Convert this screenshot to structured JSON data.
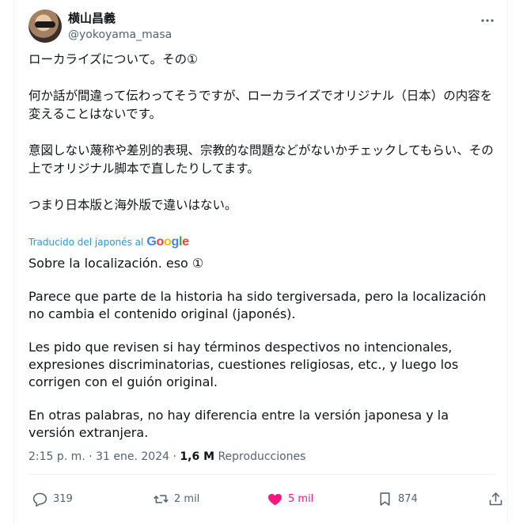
{
  "user": {
    "display_name": "横山昌義",
    "handle": "@yokoyama_masa"
  },
  "tweet": {
    "jp_paragraphs": [
      "ローカライズについて。その①",
      "何か話が間違って伝わってそうですが、ローカライズでオリジナル（日本）の内容を変えることはないです。",
      "意図しない蔑称や差別的表現、宗教的な問題などがないかチェックしてもらい、その上でオリジナル脚本で直したりしてます。",
      "つまり日本版と海外版で違いはない。"
    ],
    "translated_label": "Traducido del japonés al",
    "translator_logo": [
      "G",
      "o",
      "o",
      "g",
      "l",
      "e"
    ],
    "es_paragraphs": [
      "Sobre la localización. eso ①",
      "Parece que parte de la historia ha sido tergiversada, pero la localización no cambia el contenido original (japonés).",
      "Les pido que revisen si hay términos despectivos no intencionales, expresiones discriminatorias, cuestiones religiosas, etc., y luego los corrigen con el guión original.",
      "En otras palabras, no hay diferencia entre la versión japonesa y la versión extranjera."
    ],
    "time": "2:15 p. m.",
    "date": "31 ene. 2024",
    "separator": "·",
    "views_count": "1,6 M",
    "views_label": "Reproducciones"
  },
  "actions": {
    "replies": "319",
    "retweets": "2 mil",
    "likes": "5 mil",
    "bookmarks": "874"
  },
  "colors": {
    "accent": "#1d9bf0",
    "like": "#f91880",
    "muted": "#536471",
    "text": "#0f1419"
  }
}
